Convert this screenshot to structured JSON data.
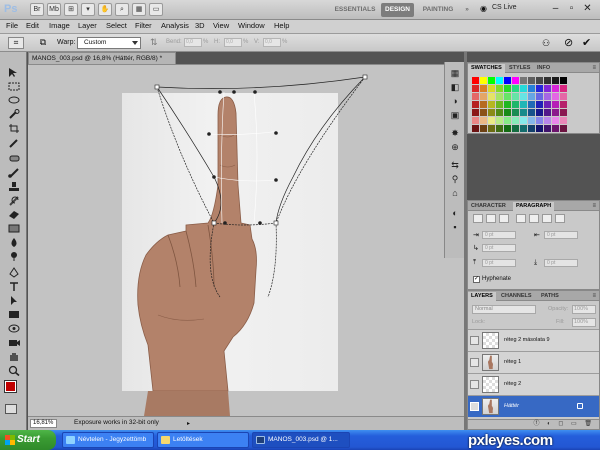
{
  "app": {
    "logo": "Ps"
  },
  "workspaces": {
    "essentials": "ESSENTIALS",
    "design": "DESIGN",
    "painting": "PAINTING",
    "more": "»",
    "cs_live": "CS Live"
  },
  "menu": [
    "File",
    "Edit",
    "Image",
    "Layer",
    "Select",
    "Filter",
    "Analysis",
    "3D",
    "View",
    "Window",
    "Help"
  ],
  "options": {
    "warp_label": "Warp:",
    "warp_value": "Custom",
    "bend_label": "Bend:",
    "bend_value": "0,0",
    "h_label": "H:",
    "h_value": "0,0",
    "v_label": "V:",
    "v_value": "0,0",
    "unit": "%"
  },
  "document": {
    "tab_title": "MANOS_003.psd @ 16,8% (Háttér, RGB/8) *",
    "zoom": "16,81%",
    "status": "Exposure works in 32-bit only",
    "status_arrow": "▸"
  },
  "colors": {
    "foreground": "#c00000",
    "background": "#000000"
  },
  "panels": {
    "swatches_tabs": [
      "SWATCHES",
      "STYLES",
      "INFO"
    ],
    "char_tabs": [
      "CHARACTER",
      "PARAGRAPH"
    ],
    "layers_tabs": [
      "LAYERS",
      "CHANNELS",
      "PATHS"
    ],
    "menu_glyph": "≡"
  },
  "paragraph": {
    "indent_left": "0 pt",
    "indent_right": "0 pt",
    "indent_first": "0 pt",
    "space_before": "0 pt",
    "space_after": "0 pt",
    "hyphenate_label": "Hyphenate",
    "hyphenate_checked": "✓"
  },
  "layers": {
    "blend_mode": "Normal",
    "opacity_label": "Opacity:",
    "opacity_value": "100%",
    "lock_label": "Lock:",
    "fill_label": "Fill:",
    "fill_value": "100%",
    "items": [
      {
        "name": "réteg 2 másolata 9"
      },
      {
        "name": "réteg 1"
      },
      {
        "name": "réteg 2"
      },
      {
        "name": "Háttér"
      }
    ],
    "bottom_icons": "ⓕ ◐ ◻ ▭ 🗑"
  },
  "taskbar": {
    "start": "Start",
    "items": [
      "Névtelen - Jegyzettömb",
      "Letöltések",
      "MANOS_003.psd @ 1..."
    ]
  },
  "watermark": "pxleyes.com"
}
